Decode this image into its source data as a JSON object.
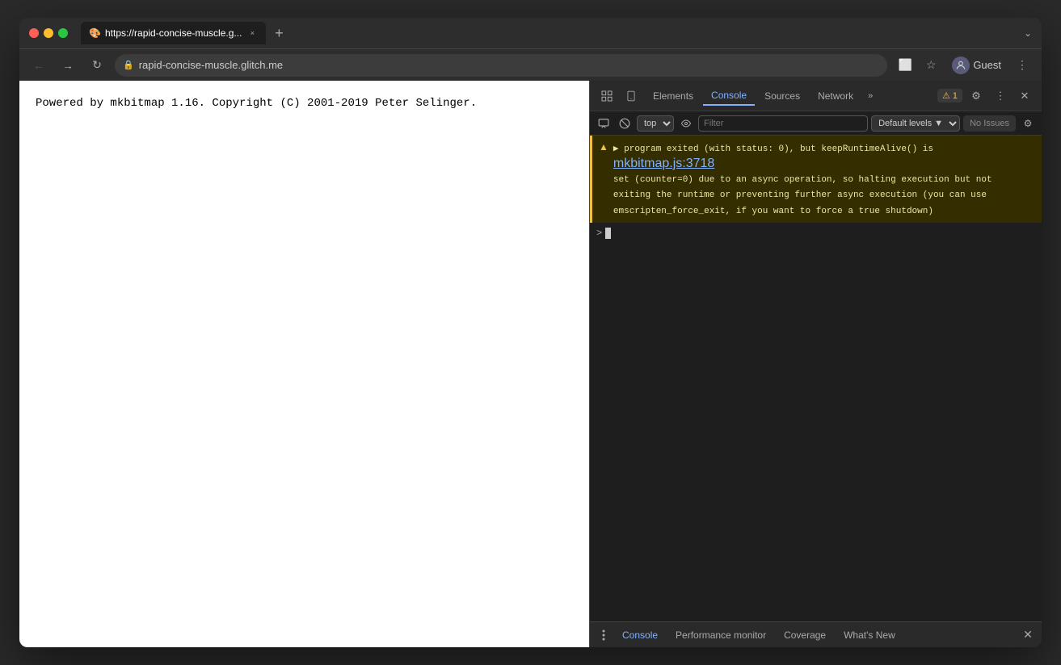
{
  "browser": {
    "tab": {
      "favicon": "🎨",
      "title": "https://rapid-concise-muscle.g...",
      "close_label": "×"
    },
    "new_tab_label": "+",
    "chevron_label": "⌄",
    "nav": {
      "back_label": "←",
      "forward_label": "→",
      "reload_label": "↻",
      "lock_label": "🔒",
      "address": "rapid-concise-muscle.glitch.me",
      "cast_label": "⬜",
      "bookmark_label": "☆",
      "profile_label": "Guest",
      "menu_label": "⋮"
    }
  },
  "page": {
    "content": "Powered by mkbitmap 1.16. Copyright (C) 2001-2019 Peter Selinger."
  },
  "devtools": {
    "toolbar": {
      "inspect_label": "⬚",
      "device_label": "📱",
      "tabs": [
        "Elements",
        "Console",
        "Sources",
        "Network"
      ],
      "more_label": "»",
      "warning_count": "1",
      "settings_label": "⚙",
      "more_menu_label": "⋮",
      "close_label": "✕"
    },
    "toolbar2": {
      "icon1_label": "⬚",
      "icon2_label": "🚫",
      "context": "top",
      "context_arrow": "▼",
      "eye_label": "👁",
      "filter_placeholder": "Filter",
      "levels_label": "Default levels",
      "levels_arrow": "▼",
      "issues_label": "No Issues",
      "gear_label": "⚙"
    },
    "console": {
      "warning_icon": "▲",
      "message_prefix": "▶",
      "message_text": "program exited (with status: 0), but keepRuntimeAlive() is",
      "message_link": "mkbitmap.js:3718",
      "message_continuation": "set (counter=0) due to an async operation, so halting execution but not\nexiting the runtime or preventing further async execution (you can use\nemscripten_force_exit, if you want to force a true shutdown)",
      "prompt_arrow": ">"
    },
    "bottom_tabs": {
      "menu_label": "⋮",
      "tabs": [
        "Console",
        "Performance monitor",
        "Coverage",
        "What's New"
      ],
      "close_label": "✕"
    }
  }
}
